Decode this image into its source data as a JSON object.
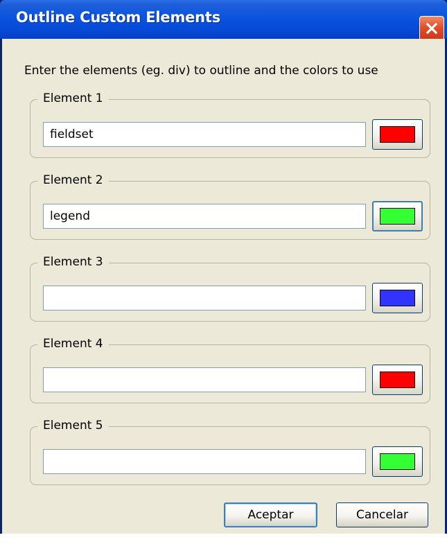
{
  "window": {
    "title": "Outline Custom Elements"
  },
  "instructions": "Enter the elements (eg. div) to outline and the colors to use",
  "elements": [
    {
      "legend": "Element 1",
      "value": "fieldset",
      "color": "#ff0000"
    },
    {
      "legend": "Element 2",
      "value": "legend",
      "color": "#33ff33"
    },
    {
      "legend": "Element 3",
      "value": "",
      "color": "#3333ff"
    },
    {
      "legend": "Element 4",
      "value": "",
      "color": "#ff0000"
    },
    {
      "legend": "Element 5",
      "value": "",
      "color": "#33ff33"
    }
  ],
  "buttons": {
    "accept_label": "Aceptar",
    "cancel_label": "Cancelar"
  },
  "icons": {
    "close": "close-icon"
  }
}
